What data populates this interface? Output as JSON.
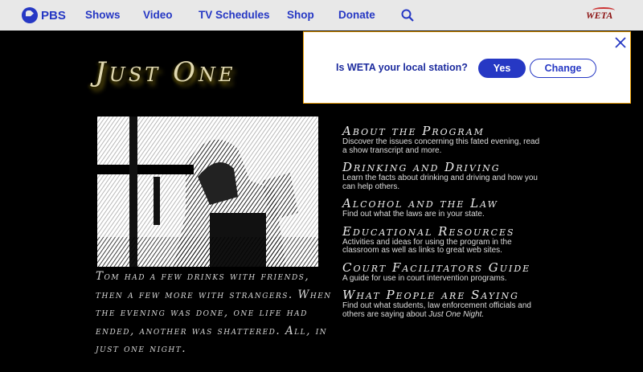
{
  "header": {
    "logo": "PBS",
    "nav": [
      "Shows",
      "Video",
      "TV Schedules",
      "Shop",
      "Donate"
    ],
    "station": "WETA"
  },
  "popup": {
    "question": "Is WETA your local station?",
    "yes": "Yes",
    "change": "Change"
  },
  "page": {
    "title": "Just One",
    "caption": "Tom had a few drinks with friends, then a few more with strangers. When the evening was done, one life had ended, another was shattered. All, in just one night."
  },
  "links": [
    {
      "title": "About the Program",
      "desc": "Discover the issues concerning this fated evening, read a show transcript and more."
    },
    {
      "title": "Drinking and Driving",
      "desc": "Learn the facts about drinking and driving and how you can help others."
    },
    {
      "title": "Alcohol and the Law",
      "desc": "Find out what the laws are in your state."
    },
    {
      "title": "Educational Resources",
      "desc": "Activities and ideas for using the program in the classroom as well as links to great web sites."
    },
    {
      "title": "Court Facilitators Guide",
      "desc": "A guide for use in court intervention programs."
    },
    {
      "title": "What People are Saying",
      "desc": "Find out what students, law enforcement officials and others are saying about",
      "desc_em": "Just One Night."
    }
  ]
}
